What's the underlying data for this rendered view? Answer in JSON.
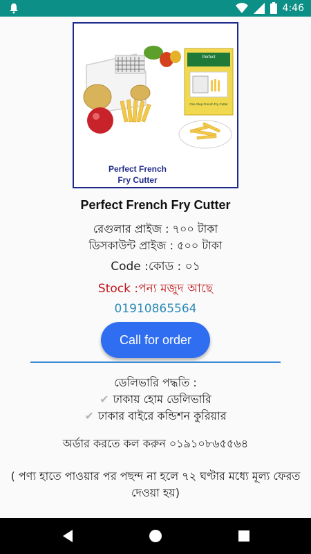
{
  "status_bar": {
    "time": "4:46",
    "icons": [
      "notification-icon",
      "wifi-icon",
      "signal-icon",
      "battery-icon"
    ]
  },
  "product": {
    "image_caption_line1": "Perfect French",
    "image_caption_line2": "Fry Cutter",
    "box_label_top": "Perfect",
    "box_label_bottom": "One Step French Fry Cutter",
    "title": "Perfect French Fry Cutter",
    "regular_price": "রেগুলার প্রাইজ : ৭০০ টাকা",
    "discount_price": "ডিসকাউন্ট প্রাইজ : ৫০০ টাকা",
    "code": "Code :কোড : ০১",
    "stock": "Stock :পন্য মজুদ আছে",
    "phone": "01910865564"
  },
  "call_button": {
    "label": "Call for order"
  },
  "delivery": {
    "heading": "ডেলিভারি পদ্ধতি :",
    "options": [
      "ঢাকায় হোম ডেলিভারি",
      "ঢাকার বাইরে কন্ডিশন কুরিয়ার"
    ]
  },
  "order_info": "অর্ডার করতে কল করুন ০১৯১০৮৬৫৫৬৪",
  "return_note": "( পণ্য হাতে পাওয়ার পর পছন্দ না হলে ৭২ ঘণ্টার মধ্যে মূল্য ফেরত দেওয়া হয়)",
  "colors": {
    "status_bar": "#0b8f86",
    "call_button": "#2f6ef0",
    "stock_text": "#c0161b",
    "phone_text": "#2a8ab8",
    "divider": "#3a8ad6",
    "frame_border": "#1e2a8a"
  },
  "nav_bar": {
    "icons": [
      "back-icon",
      "home-icon",
      "recents-icon"
    ]
  }
}
